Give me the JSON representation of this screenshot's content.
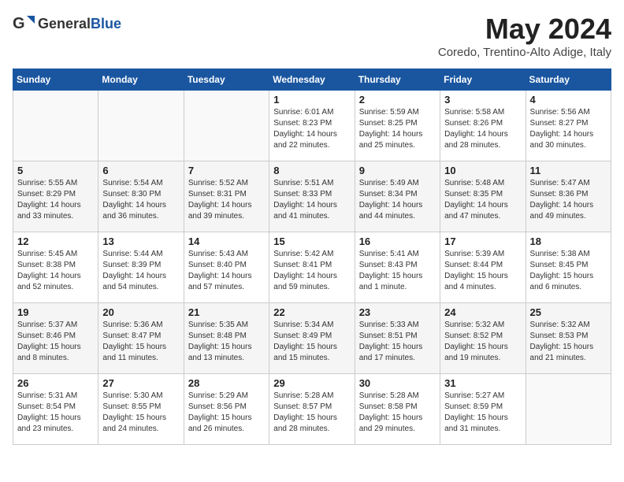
{
  "header": {
    "logo_general": "General",
    "logo_blue": "Blue",
    "month_year": "May 2024",
    "location": "Coredo, Trentino-Alto Adige, Italy"
  },
  "columns": [
    "Sunday",
    "Monday",
    "Tuesday",
    "Wednesday",
    "Thursday",
    "Friday",
    "Saturday"
  ],
  "weeks": [
    [
      {
        "day": "",
        "lines": []
      },
      {
        "day": "",
        "lines": []
      },
      {
        "day": "",
        "lines": []
      },
      {
        "day": "1",
        "lines": [
          "Sunrise: 6:01 AM",
          "Sunset: 8:23 PM",
          "Daylight: 14 hours",
          "and 22 minutes."
        ]
      },
      {
        "day": "2",
        "lines": [
          "Sunrise: 5:59 AM",
          "Sunset: 8:25 PM",
          "Daylight: 14 hours",
          "and 25 minutes."
        ]
      },
      {
        "day": "3",
        "lines": [
          "Sunrise: 5:58 AM",
          "Sunset: 8:26 PM",
          "Daylight: 14 hours",
          "and 28 minutes."
        ]
      },
      {
        "day": "4",
        "lines": [
          "Sunrise: 5:56 AM",
          "Sunset: 8:27 PM",
          "Daylight: 14 hours",
          "and 30 minutes."
        ]
      }
    ],
    [
      {
        "day": "5",
        "lines": [
          "Sunrise: 5:55 AM",
          "Sunset: 8:29 PM",
          "Daylight: 14 hours",
          "and 33 minutes."
        ]
      },
      {
        "day": "6",
        "lines": [
          "Sunrise: 5:54 AM",
          "Sunset: 8:30 PM",
          "Daylight: 14 hours",
          "and 36 minutes."
        ]
      },
      {
        "day": "7",
        "lines": [
          "Sunrise: 5:52 AM",
          "Sunset: 8:31 PM",
          "Daylight: 14 hours",
          "and 39 minutes."
        ]
      },
      {
        "day": "8",
        "lines": [
          "Sunrise: 5:51 AM",
          "Sunset: 8:33 PM",
          "Daylight: 14 hours",
          "and 41 minutes."
        ]
      },
      {
        "day": "9",
        "lines": [
          "Sunrise: 5:49 AM",
          "Sunset: 8:34 PM",
          "Daylight: 14 hours",
          "and 44 minutes."
        ]
      },
      {
        "day": "10",
        "lines": [
          "Sunrise: 5:48 AM",
          "Sunset: 8:35 PM",
          "Daylight: 14 hours",
          "and 47 minutes."
        ]
      },
      {
        "day": "11",
        "lines": [
          "Sunrise: 5:47 AM",
          "Sunset: 8:36 PM",
          "Daylight: 14 hours",
          "and 49 minutes."
        ]
      }
    ],
    [
      {
        "day": "12",
        "lines": [
          "Sunrise: 5:45 AM",
          "Sunset: 8:38 PM",
          "Daylight: 14 hours",
          "and 52 minutes."
        ]
      },
      {
        "day": "13",
        "lines": [
          "Sunrise: 5:44 AM",
          "Sunset: 8:39 PM",
          "Daylight: 14 hours",
          "and 54 minutes."
        ]
      },
      {
        "day": "14",
        "lines": [
          "Sunrise: 5:43 AM",
          "Sunset: 8:40 PM",
          "Daylight: 14 hours",
          "and 57 minutes."
        ]
      },
      {
        "day": "15",
        "lines": [
          "Sunrise: 5:42 AM",
          "Sunset: 8:41 PM",
          "Daylight: 14 hours",
          "and 59 minutes."
        ]
      },
      {
        "day": "16",
        "lines": [
          "Sunrise: 5:41 AM",
          "Sunset: 8:43 PM",
          "Daylight: 15 hours",
          "and 1 minute."
        ]
      },
      {
        "day": "17",
        "lines": [
          "Sunrise: 5:39 AM",
          "Sunset: 8:44 PM",
          "Daylight: 15 hours",
          "and 4 minutes."
        ]
      },
      {
        "day": "18",
        "lines": [
          "Sunrise: 5:38 AM",
          "Sunset: 8:45 PM",
          "Daylight: 15 hours",
          "and 6 minutes."
        ]
      }
    ],
    [
      {
        "day": "19",
        "lines": [
          "Sunrise: 5:37 AM",
          "Sunset: 8:46 PM",
          "Daylight: 15 hours",
          "and 8 minutes."
        ]
      },
      {
        "day": "20",
        "lines": [
          "Sunrise: 5:36 AM",
          "Sunset: 8:47 PM",
          "Daylight: 15 hours",
          "and 11 minutes."
        ]
      },
      {
        "day": "21",
        "lines": [
          "Sunrise: 5:35 AM",
          "Sunset: 8:48 PM",
          "Daylight: 15 hours",
          "and 13 minutes."
        ]
      },
      {
        "day": "22",
        "lines": [
          "Sunrise: 5:34 AM",
          "Sunset: 8:49 PM",
          "Daylight: 15 hours",
          "and 15 minutes."
        ]
      },
      {
        "day": "23",
        "lines": [
          "Sunrise: 5:33 AM",
          "Sunset: 8:51 PM",
          "Daylight: 15 hours",
          "and 17 minutes."
        ]
      },
      {
        "day": "24",
        "lines": [
          "Sunrise: 5:32 AM",
          "Sunset: 8:52 PM",
          "Daylight: 15 hours",
          "and 19 minutes."
        ]
      },
      {
        "day": "25",
        "lines": [
          "Sunrise: 5:32 AM",
          "Sunset: 8:53 PM",
          "Daylight: 15 hours",
          "and 21 minutes."
        ]
      }
    ],
    [
      {
        "day": "26",
        "lines": [
          "Sunrise: 5:31 AM",
          "Sunset: 8:54 PM",
          "Daylight: 15 hours",
          "and 23 minutes."
        ]
      },
      {
        "day": "27",
        "lines": [
          "Sunrise: 5:30 AM",
          "Sunset: 8:55 PM",
          "Daylight: 15 hours",
          "and 24 minutes."
        ]
      },
      {
        "day": "28",
        "lines": [
          "Sunrise: 5:29 AM",
          "Sunset: 8:56 PM",
          "Daylight: 15 hours",
          "and 26 minutes."
        ]
      },
      {
        "day": "29",
        "lines": [
          "Sunrise: 5:28 AM",
          "Sunset: 8:57 PM",
          "Daylight: 15 hours",
          "and 28 minutes."
        ]
      },
      {
        "day": "30",
        "lines": [
          "Sunrise: 5:28 AM",
          "Sunset: 8:58 PM",
          "Daylight: 15 hours",
          "and 29 minutes."
        ]
      },
      {
        "day": "31",
        "lines": [
          "Sunrise: 5:27 AM",
          "Sunset: 8:59 PM",
          "Daylight: 15 hours",
          "and 31 minutes."
        ]
      },
      {
        "day": "",
        "lines": []
      }
    ]
  ]
}
